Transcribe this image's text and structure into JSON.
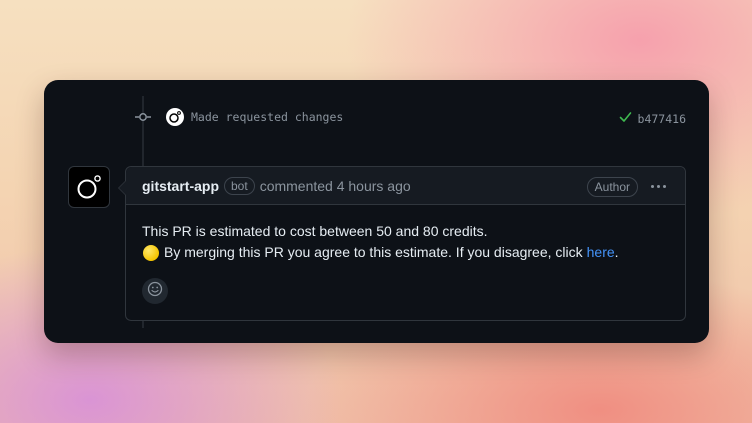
{
  "commit": {
    "message": "Made requested changes",
    "sha": "b477416",
    "status_icon": "check-icon",
    "status_color": "#3fb950"
  },
  "comment": {
    "author": "gitstart-app",
    "bot_label": "bot",
    "action": "commented 4 hours ago",
    "author_badge": "Author",
    "menu_icon": "kebab-horizontal-icon",
    "body": {
      "line1": "This PR is estimated to cost between 50 and 80 credits.",
      "emoji": "yellow-circle",
      "line2": "By merging this PR you agree to this estimate. If you disagree, click",
      "link_text": "here",
      "line2_end": "."
    },
    "reaction_icon": "smiley-icon"
  },
  "colors": {
    "card_bg": "#0d1117",
    "header_bg": "#161b22",
    "border": "#30363d",
    "text_primary": "#e6edf3",
    "text_muted": "#8b949e",
    "link": "#4493f8",
    "success": "#3fb950"
  }
}
